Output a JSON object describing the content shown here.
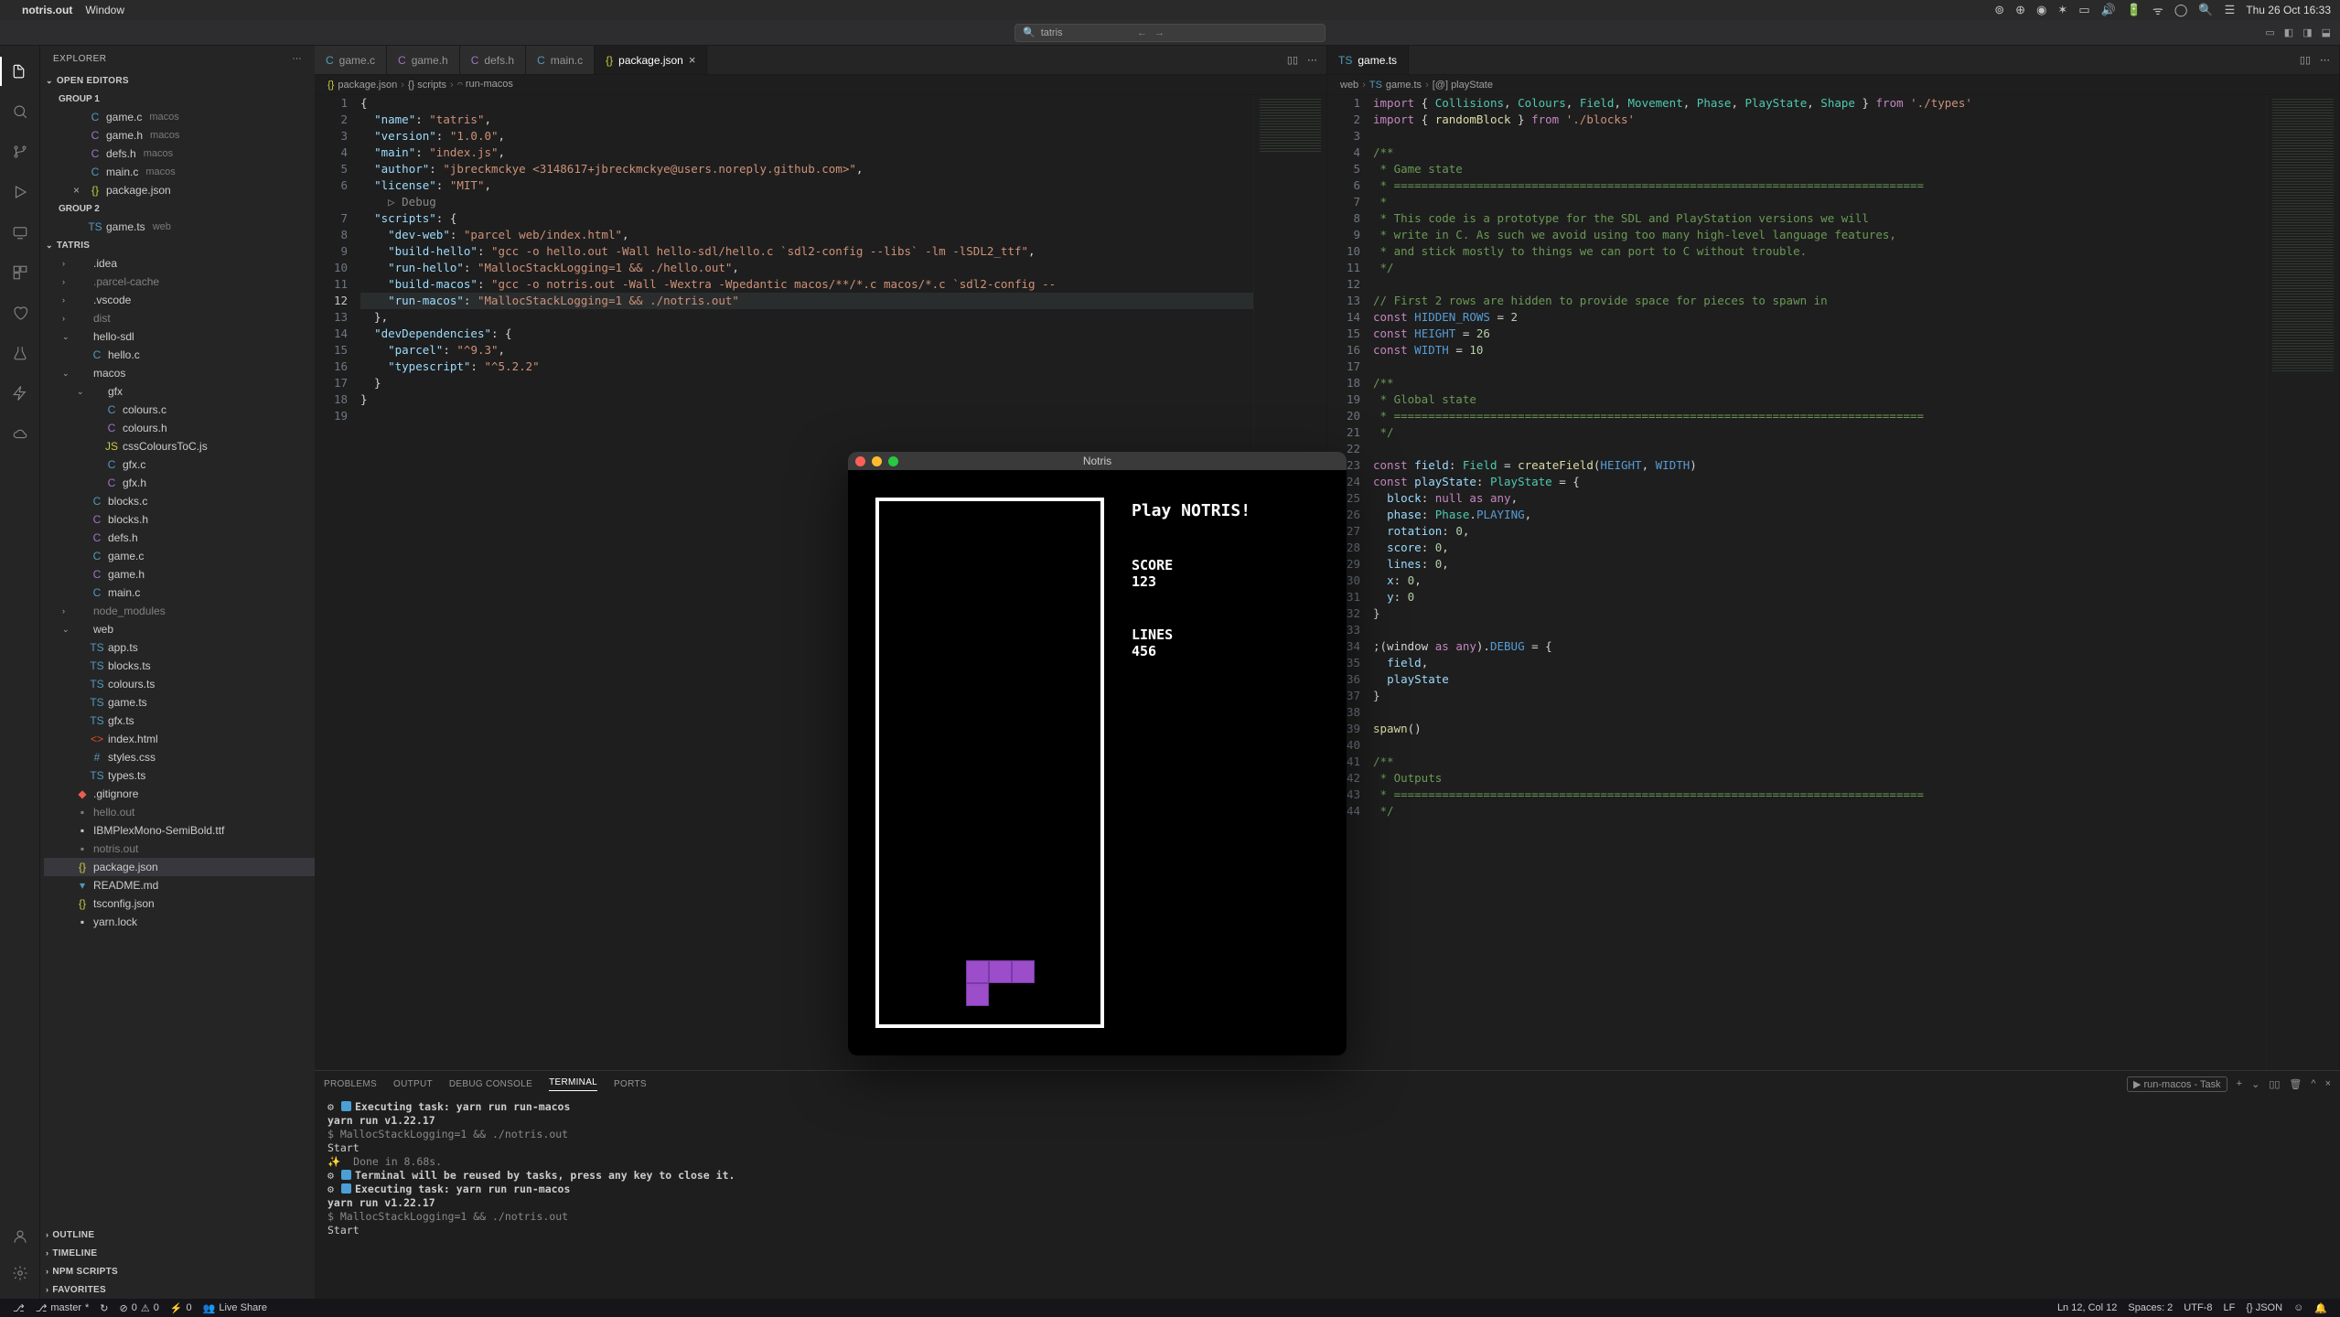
{
  "menubar": {
    "app": "notris.out",
    "menu": "Window",
    "datetime": "Thu 26 Oct 16:33"
  },
  "titlebar": {
    "search_placeholder": "tatris"
  },
  "sidebar": {
    "title": "EXPLORER",
    "sections": {
      "open_editors": "OPEN EDITORS",
      "group1": "GROUP 1",
      "group2": "GROUP 2",
      "project": "TATRIS",
      "outline": "OUTLINE",
      "timeline": "TIMELINE",
      "npm_scripts": "NPM SCRIPTS",
      "favorites": "FAVORITES"
    },
    "open_editors_g1": [
      {
        "name": "game.c",
        "hint": "macos",
        "cls": "file-c"
      },
      {
        "name": "game.h",
        "hint": "macos",
        "cls": "file-h"
      },
      {
        "name": "defs.h",
        "hint": "macos",
        "cls": "file-h"
      },
      {
        "name": "main.c",
        "hint": "macos",
        "cls": "file-c"
      },
      {
        "name": "package.json",
        "hint": "",
        "cls": "file-json",
        "close": true
      }
    ],
    "open_editors_g2": [
      {
        "name": "game.ts",
        "hint": "web",
        "cls": "file-ts"
      }
    ],
    "tree": [
      {
        "name": ".idea",
        "cls": "file-folder",
        "indent": 1,
        "chev": "›"
      },
      {
        "name": ".parcel-cache",
        "cls": "file-folder",
        "indent": 1,
        "chev": "›",
        "dim": true
      },
      {
        "name": ".vscode",
        "cls": "file-folder",
        "indent": 1,
        "chev": "›"
      },
      {
        "name": "dist",
        "cls": "file-folder",
        "indent": 1,
        "chev": "›",
        "dim": true
      },
      {
        "name": "hello-sdl",
        "cls": "file-folder",
        "indent": 1,
        "chev": "⌄"
      },
      {
        "name": "hello.c",
        "cls": "file-c",
        "indent": 2
      },
      {
        "name": "macos",
        "cls": "file-folder",
        "indent": 1,
        "chev": "⌄"
      },
      {
        "name": "gfx",
        "cls": "file-folder",
        "indent": 2,
        "chev": "⌄"
      },
      {
        "name": "colours.c",
        "cls": "file-c",
        "indent": 3
      },
      {
        "name": "colours.h",
        "cls": "file-h",
        "indent": 3
      },
      {
        "name": "cssColoursToC.js",
        "cls": "file-js",
        "indent": 3
      },
      {
        "name": "gfx.c",
        "cls": "file-c",
        "indent": 3
      },
      {
        "name": "gfx.h",
        "cls": "file-h",
        "indent": 3
      },
      {
        "name": "blocks.c",
        "cls": "file-c",
        "indent": 2
      },
      {
        "name": "blocks.h",
        "cls": "file-h",
        "indent": 2
      },
      {
        "name": "defs.h",
        "cls": "file-h",
        "indent": 2
      },
      {
        "name": "game.c",
        "cls": "file-c",
        "indent": 2
      },
      {
        "name": "game.h",
        "cls": "file-h",
        "indent": 2
      },
      {
        "name": "main.c",
        "cls": "file-c",
        "indent": 2
      },
      {
        "name": "node_modules",
        "cls": "file-folder",
        "indent": 1,
        "chev": "›",
        "dim": true
      },
      {
        "name": "web",
        "cls": "file-folder",
        "indent": 1,
        "chev": "⌄"
      },
      {
        "name": "app.ts",
        "cls": "file-ts",
        "indent": 2
      },
      {
        "name": "blocks.ts",
        "cls": "file-ts",
        "indent": 2
      },
      {
        "name": "colours.ts",
        "cls": "file-ts",
        "indent": 2
      },
      {
        "name": "game.ts",
        "cls": "file-ts",
        "indent": 2
      },
      {
        "name": "gfx.ts",
        "cls": "file-ts",
        "indent": 2
      },
      {
        "name": "index.html",
        "cls": "file-html",
        "indent": 2
      },
      {
        "name": "styles.css",
        "cls": "file-css",
        "indent": 2
      },
      {
        "name": "types.ts",
        "cls": "file-ts",
        "indent": 2
      },
      {
        "name": ".gitignore",
        "cls": "file-git",
        "indent": 1
      },
      {
        "name": "hello.out",
        "cls": "",
        "indent": 1,
        "dim": true
      },
      {
        "name": "IBMPlexMono-SemiBold.ttf",
        "cls": "",
        "indent": 1
      },
      {
        "name": "notris.out",
        "cls": "",
        "indent": 1,
        "dim": true
      },
      {
        "name": "package.json",
        "cls": "file-json",
        "indent": 1,
        "selected": true
      },
      {
        "name": "README.md",
        "cls": "file-md",
        "indent": 1
      },
      {
        "name": "tsconfig.json",
        "cls": "file-json",
        "indent": 1
      },
      {
        "name": "yarn.lock",
        "cls": "",
        "indent": 1
      }
    ]
  },
  "left_editor": {
    "tabs": [
      {
        "label": "game.c",
        "cls": "file-c"
      },
      {
        "label": "game.h",
        "cls": "file-h"
      },
      {
        "label": "defs.h",
        "cls": "file-h"
      },
      {
        "label": "main.c",
        "cls": "file-c"
      },
      {
        "label": "package.json",
        "cls": "file-json",
        "active": true,
        "close": true
      }
    ],
    "breadcrumb": [
      "package.json",
      "{} scripts",
      "𝄐 run-macos"
    ],
    "json": {
      "name": "tatris",
      "version": "1.0.0",
      "main": "index.js",
      "author": "jbreckmckye <3148617+jbreckmckye@users.noreply.github.com>",
      "license": "MIT",
      "scripts": {
        "dev-web": "parcel web/index.html",
        "build-hello": "gcc -o hello.out -Wall hello-sdl/hello.c `sdl2-config --libs` -lm -lSDL2_ttf",
        "run-hello": "MallocStackLogging=1 && ./hello.out",
        "build-macos": "gcc -o notris.out -Wall -Wextra -Wpedantic macos/**/*.c macos/*.c `sdl2-config --",
        "run-macos": "MallocStackLogging=1 && ./notris.out"
      },
      "devDependencies": {
        "parcel": "^9.3",
        "typescript": "^5.2.2"
      }
    },
    "debug_inlay": "Debug",
    "current_line": 12,
    "total_lines": 19
  },
  "right_editor": {
    "tabs": [
      {
        "label": "game.ts",
        "cls": "file-ts",
        "active": true
      }
    ],
    "breadcrumb": [
      "web",
      "game.ts",
      "[@] playState"
    ],
    "lines": [
      "import { Collisions, Colours, Field, Movement, Phase, PlayState, Shape } from './types'",
      "import { randomBlock } from './blocks'",
      "",
      "/**",
      " * Game state",
      " * =============================================================================",
      " *",
      " * This code is a prototype for the SDL and PlayStation versions we will",
      " * write in C. As such we avoid using too many high-level language features,",
      " * and stick mostly to things we can port to C without trouble.",
      " */",
      "",
      "// First 2 rows are hidden to provide space for pieces to spawn in",
      "const HIDDEN_ROWS = 2",
      "const HEIGHT = 26",
      "const WIDTH = 10",
      "",
      "/**",
      " * Global state",
      " * =============================================================================",
      " */",
      "",
      "const field: Field = createField(HEIGHT, WIDTH)",
      "const playState: PlayState = {",
      "  block: null as any,",
      "  phase: Phase.PLAYING,",
      "  rotation: 0,",
      "  score: 0,",
      "  lines: 0,",
      "  x: 0,",
      "  y: 0",
      "}",
      "",
      ";(window as any).DEBUG = {",
      "  field,",
      "  playState",
      "}",
      "",
      "spawn()",
      "",
      "/**",
      " * Outputs",
      " * =============================================================================",
      " */"
    ]
  },
  "panel": {
    "tabs": [
      "PROBLEMS",
      "OUTPUT",
      "DEBUG CONSOLE",
      "TERMINAL",
      "PORTS"
    ],
    "active_tab": "TERMINAL",
    "task_badge": "run-macos - Task",
    "terminal": [
      {
        "t": "task",
        "text": "Executing task: yarn run run-macos"
      },
      {
        "t": "",
        "text": ""
      },
      {
        "t": "bold",
        "text": "yarn run v1.22.17"
      },
      {
        "t": "dim",
        "text": "$ MallocStackLogging=1 && ./notris.out"
      },
      {
        "t": "",
        "text": "Start"
      },
      {
        "t": "dim",
        "text": "✨  Done in 8.68s."
      },
      {
        "t": "task",
        "text": "Terminal will be reused by tasks, press any key to close it."
      },
      {
        "t": "",
        "text": ""
      },
      {
        "t": "task",
        "text": "Executing task: yarn run run-macos"
      },
      {
        "t": "",
        "text": ""
      },
      {
        "t": "bold",
        "text": "yarn run v1.22.17"
      },
      {
        "t": "dim",
        "text": "$ MallocStackLogging=1 && ./notris.out"
      },
      {
        "t": "",
        "text": "Start"
      }
    ]
  },
  "statusbar": {
    "branch": "master",
    "sync": "↻",
    "errors": "0",
    "warnings": "0",
    "ports": "0",
    "liveshare": "Live Share",
    "position": "Ln 12, Col 12",
    "spaces": "Spaces: 2",
    "encoding": "UTF-8",
    "eol": "LF",
    "lang": "{} JSON",
    "bell": "🔔"
  },
  "game": {
    "title": "Notris",
    "headline": "Play NOTRIS!",
    "score_label": "SCORE",
    "score_value": "123",
    "lines_label": "LINES",
    "lines_value": "456"
  }
}
